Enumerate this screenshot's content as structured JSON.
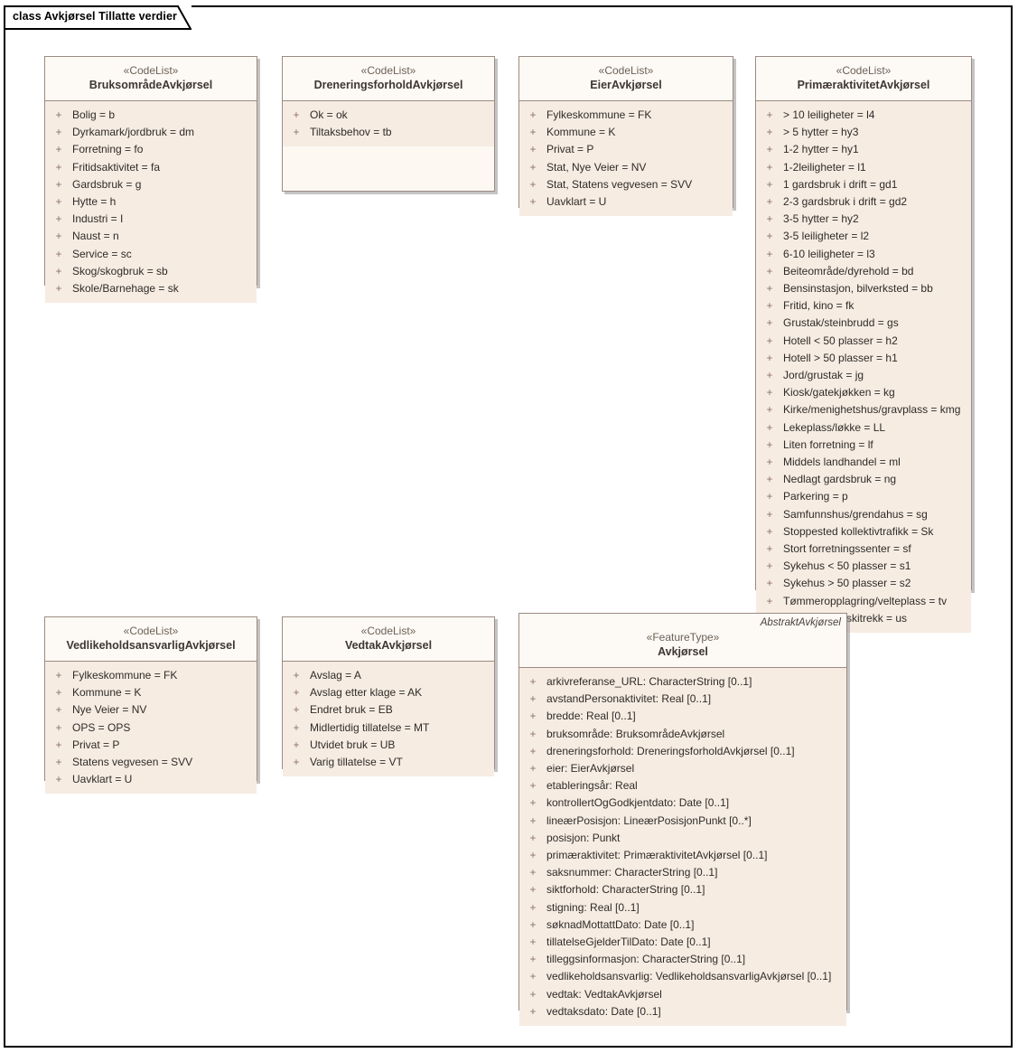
{
  "diagram": {
    "frame_title": "class Avkjørsel Tillatte verdier",
    "stereotype_codelist": "«CodeList»",
    "stereotype_featuretype": "«FeatureType»",
    "visibility_public": "+",
    "colors": {
      "frame_border": "#000000",
      "class_border": "#9c8b84",
      "header_fill": "#fdf9f4",
      "body_fill": "#f6ece2",
      "shadow": "#969292",
      "stereotype_text": "#6b6258",
      "class_name_text": "#3d3733",
      "attribute_text": "#2f2b28",
      "visibility_text": "#8d6f66"
    }
  },
  "classes": [
    {
      "id": "bruksomrade",
      "stereotype": "«CodeList»",
      "name": "BruksområdeAvkjørsel",
      "abstract_tag": null,
      "attributes": [
        "Bolig = b",
        "Dyrkamark/jordbruk = dm",
        "Forretning = fo",
        "Fritidsaktivitet = fa",
        "Gardsbruk = g",
        "Hytte = h",
        "Industri = I",
        "Naust = n",
        "Service = sc",
        "Skog/skogbruk = sb",
        "Skole/Barnehage = sk"
      ]
    },
    {
      "id": "dreneringsforhold",
      "stereotype": "«CodeList»",
      "name": "DreneringsforholdAvkjørsel",
      "abstract_tag": null,
      "attributes": [
        "Ok = ok",
        "Tiltaksbehov = tb"
      ]
    },
    {
      "id": "eier",
      "stereotype": "«CodeList»",
      "name": "EierAvkjørsel",
      "abstract_tag": null,
      "attributes": [
        "Fylkeskommune = FK",
        "Kommune = K",
        "Privat = P",
        "Stat, Nye Veier = NV",
        "Stat, Statens vegvesen = SVV",
        "Uavklart = U"
      ]
    },
    {
      "id": "primaeraktivitet",
      "stereotype": "«CodeList»",
      "name": "PrimæraktivitetAvkjørsel",
      "abstract_tag": null,
      "attributes": [
        "> 10 leiligheter = l4",
        "> 5 hytter = hy3",
        "1-2 hytter = hy1",
        "1-2leiligheter = l1",
        "1 gardsbruk i drift = gd1",
        "2-3 gardsbruk i drift = gd2",
        "3-5 hytter = hy2",
        "3-5 leiligheter = l2",
        "6-10 leiligheter = l3",
        "Beiteområde/dyrehold = bd",
        "Bensinstasjon, bilverksted = bb",
        "Fritid, kino = fk",
        "Grustak/steinbrudd = gs",
        "Hotell < 50 plasser = h2",
        "Hotell > 50 plasser = h1",
        "Jord/grustak = jg",
        "Kiosk/gatekjøkken = kg",
        "Kirke/menighetshus/gravplass = kmg",
        "Lekeplass/løkke = LL",
        "Liten forretning = lf",
        "Middels landhandel = ml",
        "Nedlagt gardsbruk = ng",
        "Parkering = p",
        "Samfunnshus/grendahus = sg",
        "Stoppested kollektivtrafikk = Sk",
        "Stort forretningssenter = sf",
        "Sykehus < 50 plasser = s1",
        "Sykehus > 50 plasser = s2",
        "Tømmeropplagring/velteplass = tv",
        "Utfartsplass, skitrekk = us"
      ]
    },
    {
      "id": "vedlikehold",
      "stereotype": "«CodeList»",
      "name": "VedlikeholdsansvarligAvkjørsel",
      "abstract_tag": null,
      "attributes": [
        "Fylkeskommune = FK",
        "Kommune = K",
        "Nye Veier = NV",
        "OPS = OPS",
        "Privat = P",
        "Statens vegvesen = SVV",
        "Uavklart = U"
      ]
    },
    {
      "id": "vedtak",
      "stereotype": "«CodeList»",
      "name": "VedtakAvkjørsel",
      "abstract_tag": null,
      "attributes": [
        "Avslag = A",
        "Avslag etter klage = AK",
        "Endret bruk = EB",
        "Midlertidig tillatelse = MT",
        "Utvidet bruk = UB",
        "Varig tillatelse = VT"
      ]
    },
    {
      "id": "avkjorsel",
      "stereotype": "«FeatureType»",
      "name": "Avkjørsel",
      "abstract_tag": "AbstraktAvkjørsel",
      "attributes": [
        "arkivreferanse_URL: CharacterString [0..1]",
        "avstandPersonaktivitet: Real [0..1]",
        "bredde: Real [0..1]",
        "bruksområde: BruksområdeAvkjørsel",
        "dreneringsforhold: DreneringsforholdAvkjørsel [0..1]",
        "eier: EierAvkjørsel",
        "etableringsår: Real",
        "kontrollertOgGodkjentdato: Date [0..1]",
        "lineærPosisjon: LineærPosisjonPunkt [0..*]",
        "posisjon: Punkt",
        "primæraktivitet: PrimæraktivitetAvkjørsel [0..1]",
        "saksnummer: CharacterString [0..1]",
        "siktforhold: CharacterString [0..1]",
        "stigning: Real [0..1]",
        "søknadMottattDato: Date [0..1]",
        "tillatelseGjelderTilDato: Date [0..1]",
        "tilleggsinformasjon: CharacterString [0..1]",
        "vedlikeholdsansvarlig: VedlikeholdsansvarligAvkjørsel [0..1]",
        "vedtak: VedtakAvkjørsel",
        "vedtaksdato: Date [0..1]"
      ]
    }
  ]
}
